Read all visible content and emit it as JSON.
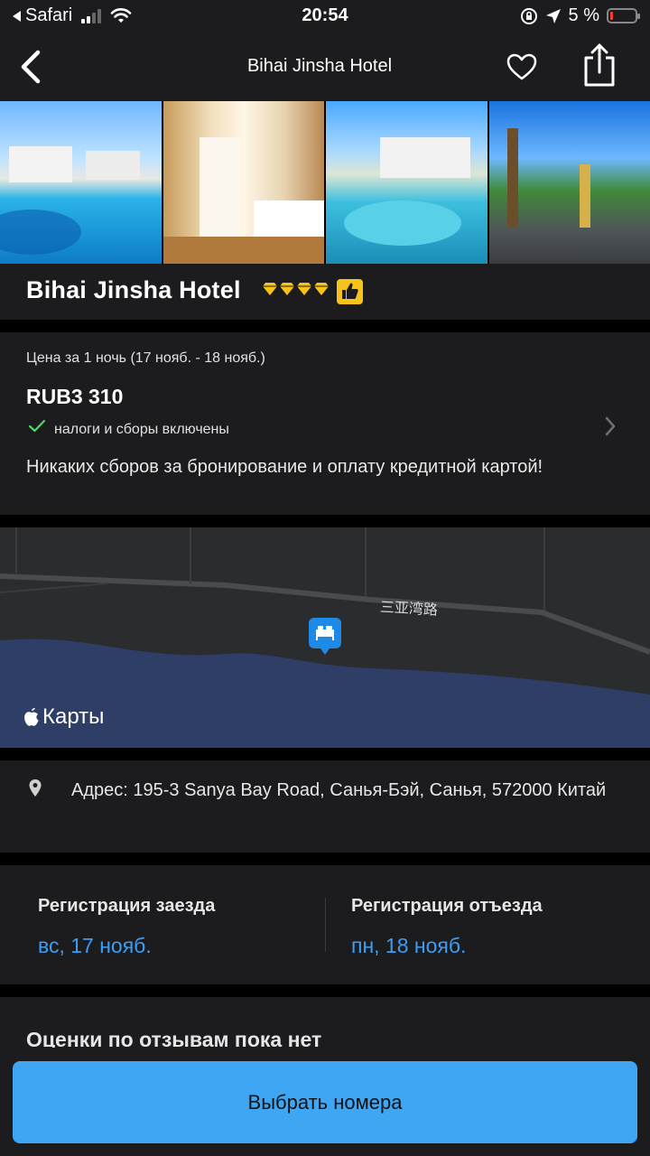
{
  "status_bar": {
    "carrier": "Safari",
    "time": "20:54",
    "battery_percent": "5 %",
    "battery_level": 0.05
  },
  "nav": {
    "title": "Bihai Jinsha Hotel",
    "icons": [
      "back-chevron",
      "heart-outline",
      "share"
    ]
  },
  "gallery": {
    "photo_count": 4
  },
  "hotel": {
    "name": "Bihai Jinsha Hotel",
    "rating_diamonds": 4,
    "badge": "thumbs-up"
  },
  "price": {
    "label": "Цена за 1 ночь (17 нояб. - 18 нояб.)",
    "amount": "RUB3 310",
    "taxes_note": "налоги и сборы включены",
    "fees_note": "Никаких сборов за бронирование и оплату кредитной картой!"
  },
  "map": {
    "road_label": "三亚湾路",
    "brand": "Карты"
  },
  "address": {
    "text": "Адрес: 195-3 Sanya Bay Road, Санья-Бэй, Санья, 572000 Китай"
  },
  "dates": {
    "checkin_label": "Регистрация заезда",
    "checkin_date": "вс, 17 нояб.",
    "checkout_label": "Регистрация отъезда",
    "checkout_date": "пн, 18 нояб."
  },
  "reviews": {
    "title": "Оценки по отзывам пока нет"
  },
  "cta": {
    "label": "Выбрать номера"
  },
  "colors": {
    "background": "#000000",
    "card": "#1c1c1e",
    "accent_blue": "#3d9df5",
    "cta_blue": "#3fa6f4",
    "gold": "#f7c21a",
    "check_green": "#4cd964"
  }
}
